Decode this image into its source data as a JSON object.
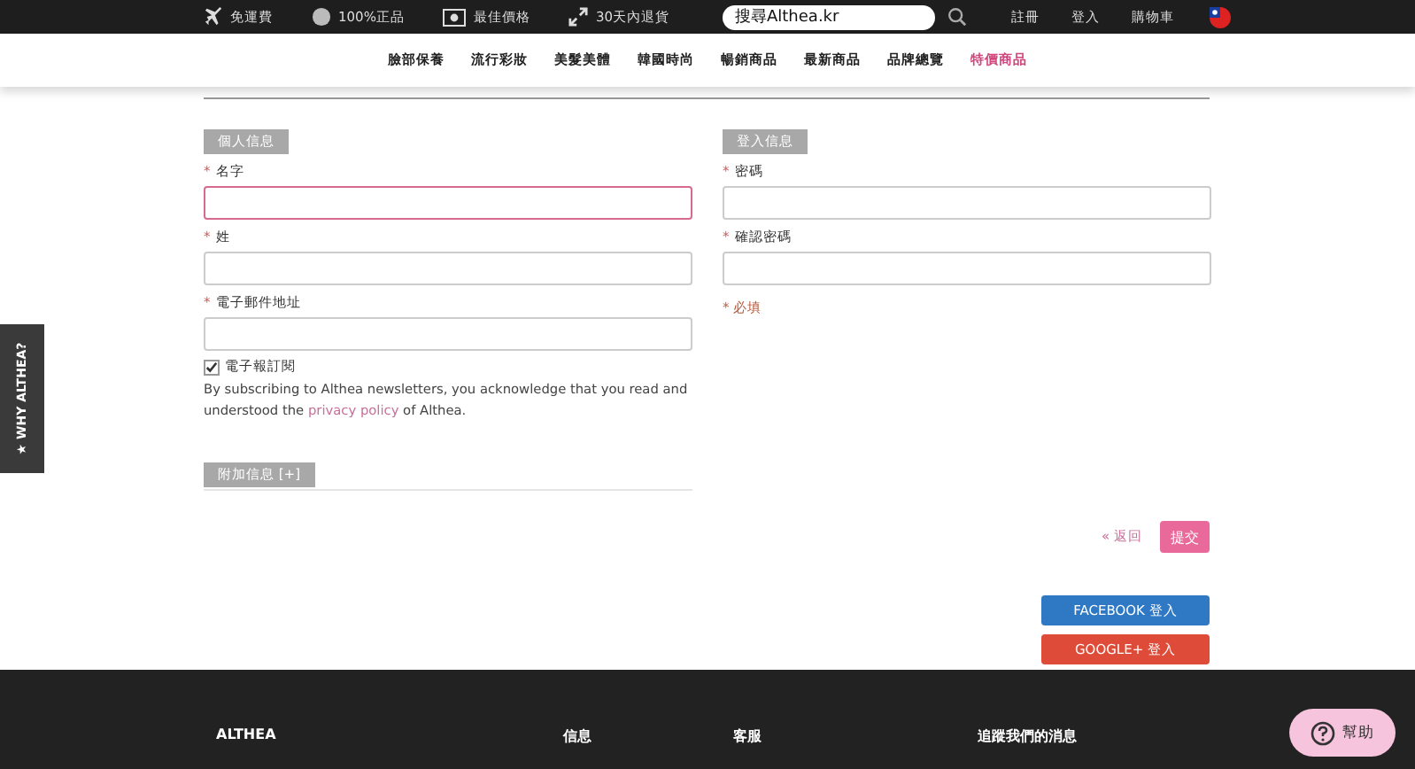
{
  "top_bar": {
    "perks": [
      {
        "kind": "plane",
        "label": "免運費"
      },
      {
        "kind": "circle",
        "label": "100%正品"
      },
      {
        "kind": "cash",
        "label": "最佳價格"
      },
      {
        "kind": "arrows",
        "label": "30天內退貨"
      }
    ],
    "search": {
      "placeholder": "搜尋Althea.kr"
    },
    "links": [
      "註冊",
      "登入",
      "購物車"
    ]
  },
  "nav": [
    {
      "label": "臉部保養",
      "selected": false
    },
    {
      "label": "流行彩妝",
      "selected": false
    },
    {
      "label": "美髮美體",
      "selected": false
    },
    {
      "label": "韓國時尚",
      "selected": false
    },
    {
      "label": "暢銷商品",
      "selected": false
    },
    {
      "label": "最新商品",
      "selected": false
    },
    {
      "label": "品牌總覽",
      "selected": false
    },
    {
      "label": "特價商品",
      "selected": true
    }
  ],
  "side_tab": "★ WHY ALTHEA?",
  "personal": {
    "heading": "個人信息",
    "fields": [
      {
        "marker": "*",
        "label": "名字",
        "focused": true
      },
      {
        "marker": "*",
        "label": "姓",
        "focused": false
      },
      {
        "marker": "*",
        "label": "電子郵件地址",
        "focused": false
      }
    ],
    "newsletter": {
      "label": "電子報訂閱",
      "checked": true
    },
    "note": {
      "before": "By subscribing to Althea newsletters, you acknowledge that you read and understood the ",
      "link": "privacy policy",
      "after": " of Althea."
    },
    "extra_heading": "附加信息 [+]"
  },
  "login": {
    "heading": "登入信息",
    "fields": [
      {
        "marker": "*",
        "label": "密碼",
        "focused": false
      },
      {
        "marker": "*",
        "label": "確認密碼",
        "focused": false
      }
    ],
    "required_note": "* 必填"
  },
  "actions": {
    "back": "« 返回",
    "submit": "提交"
  },
  "social": [
    {
      "kind": "facebook",
      "label": "FACEBOOK 登入"
    },
    {
      "kind": "google",
      "label": "GOOGLE+ 登入"
    }
  ],
  "footer": {
    "columns": [
      "ALTHEA",
      "信息",
      "客服",
      "追蹤我們的消息"
    ]
  },
  "help": "幫助"
}
